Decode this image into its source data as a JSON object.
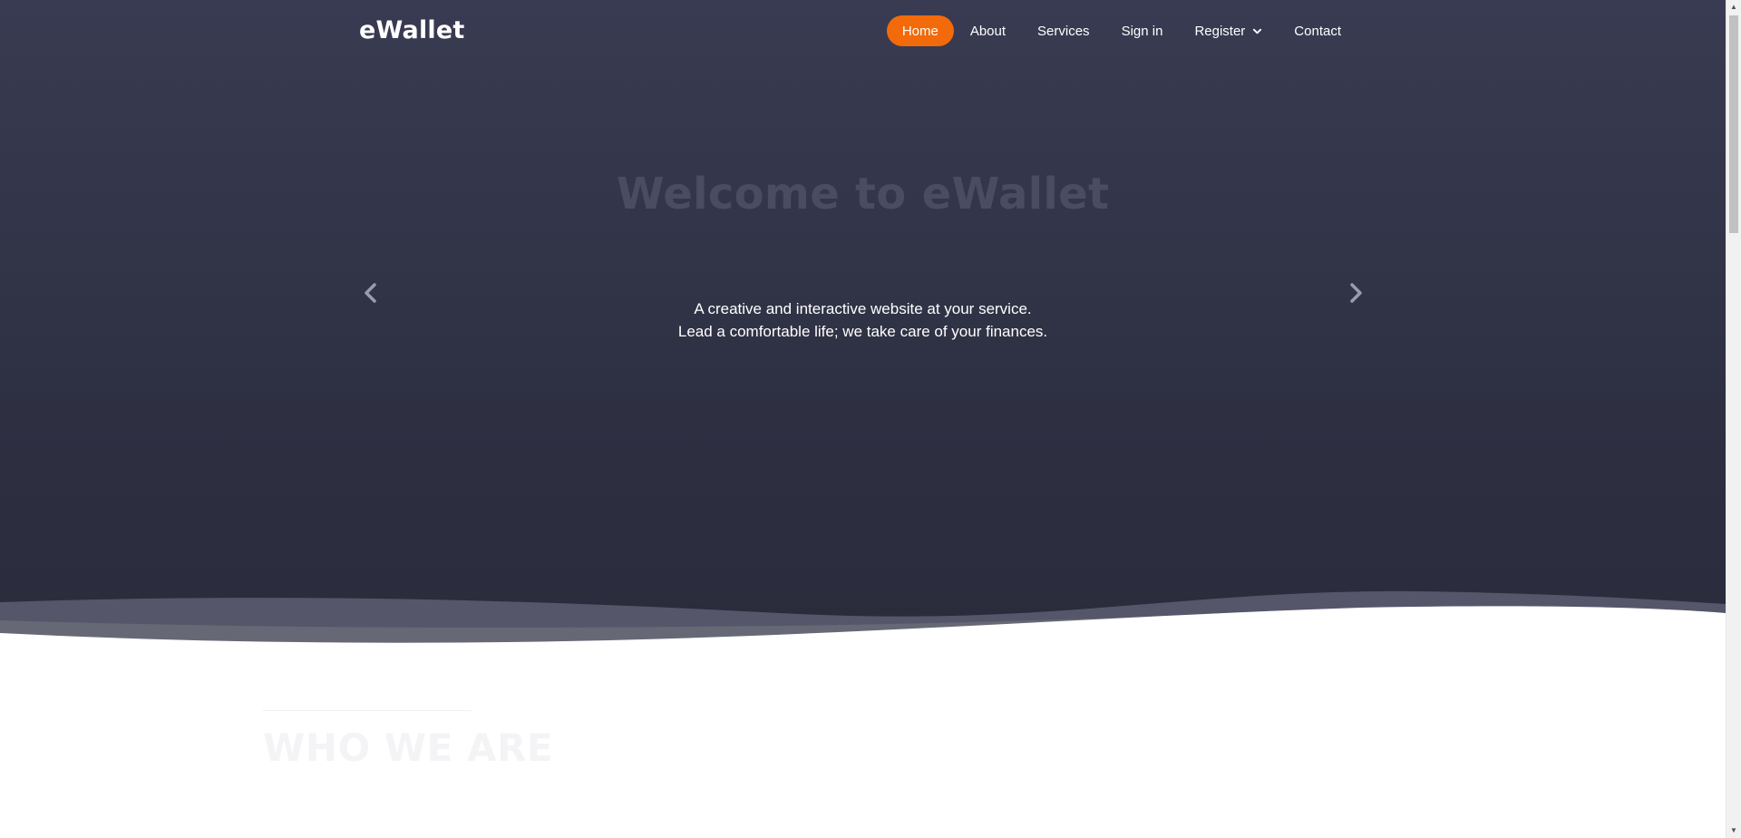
{
  "brand": {
    "logo": "eWallet"
  },
  "nav": {
    "items": [
      {
        "label": "Home",
        "active": true
      },
      {
        "label": "About"
      },
      {
        "label": "Services"
      },
      {
        "label": "Sign in"
      },
      {
        "label": "Register",
        "has_dropdown": true
      },
      {
        "label": "Contact"
      }
    ]
  },
  "hero": {
    "title": "Welcome to eWallet",
    "subtitle_line1": "A creative and interactive website at your service.",
    "subtitle_line2": "Lead a comfortable life; we take care of your finances.",
    "prev_icon": "chevron-left-icon",
    "next_icon": "chevron-right-icon"
  },
  "section": {
    "heading": "WHO WE ARE"
  },
  "colors": {
    "accent": "#f26a0a",
    "hero_bg_top": "#393b52",
    "hero_bg_bottom": "#2a2b3b",
    "wave": "#6b6c78"
  }
}
